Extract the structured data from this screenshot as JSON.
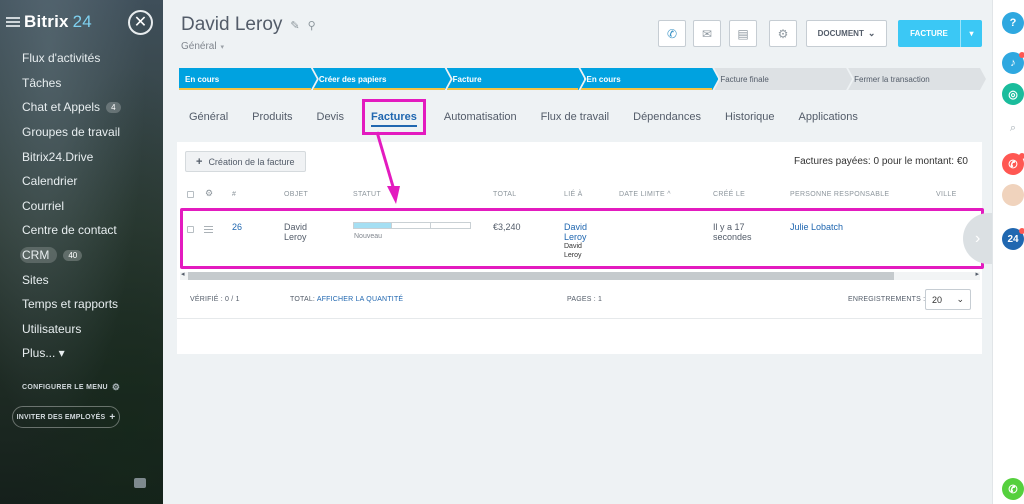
{
  "sidebar": {
    "brand_name": "Bitrix",
    "brand_num": "24",
    "items": [
      {
        "label": "Flux d'activités"
      },
      {
        "label": "Tâches"
      },
      {
        "label": "Chat et Appels",
        "count": "4"
      },
      {
        "label": "Groupes de travail"
      },
      {
        "label": "Bitrix24.Drive"
      },
      {
        "label": "Calendrier"
      },
      {
        "label": "Courriel"
      },
      {
        "label": "Centre de contact"
      },
      {
        "label": "CRM",
        "count": "40"
      },
      {
        "label": "Sites"
      },
      {
        "label": "Temps et rapports"
      },
      {
        "label": "Utilisateurs"
      },
      {
        "label": "Plus... ▾"
      }
    ],
    "configure_label": "CONFIGURER LE MENU",
    "invite_label": "INVITER DES EMPLOYÉS"
  },
  "header": {
    "title": "David Leroy",
    "subtitle": "Général",
    "document_label": "DOCUMENT",
    "facture_label": "FACTURE"
  },
  "pipeline": [
    {
      "label": "En cours"
    },
    {
      "label": "Créer des papiers"
    },
    {
      "label": "Facture"
    },
    {
      "label": "En cours"
    },
    {
      "label": "Facture finale"
    },
    {
      "label": "Fermer la transaction"
    }
  ],
  "tabs": [
    {
      "label": "Général"
    },
    {
      "label": "Produits"
    },
    {
      "label": "Devis"
    },
    {
      "label": "Factures"
    },
    {
      "label": "Automatisation"
    },
    {
      "label": "Flux de travail"
    },
    {
      "label": "Dépendances"
    },
    {
      "label": "Historique"
    },
    {
      "label": "Applications"
    }
  ],
  "invoices": {
    "create_label": "Création de la facture",
    "paid_info": "Factures payées: 0 pour le montant: €0",
    "columns": [
      "#",
      "OBJET",
      "STATUT",
      "TOTAL",
      "LIÉ À",
      "DATE LIMITE ^",
      "CRÉÉ LE",
      "PERSONNE RESPONSABLE",
      "VILLE"
    ],
    "row": {
      "id": "26",
      "object": "David\nLeroy",
      "status": "Nouveau",
      "status_progress": 0.33,
      "total": "€3,240",
      "linked_link": "David\nLeroy",
      "linked_sub": "David\nLeroy",
      "created": "Il y a 17\nsecondes",
      "responsible": "Julie Lobatch"
    },
    "footer": {
      "verified_label": "VÉRIFIÉ : 0 / 1",
      "total_label": "TOTAL:",
      "total_link": "AFFICHER LA QUANTITÉ",
      "pages_label": "PAGES : 1",
      "records_label": "ENREGISTREMENTS :",
      "records_value": "20"
    }
  },
  "colors": {
    "highlight": "#e31bbf",
    "accent": "#3bc8f5",
    "stage_done": "#00a2e0"
  }
}
